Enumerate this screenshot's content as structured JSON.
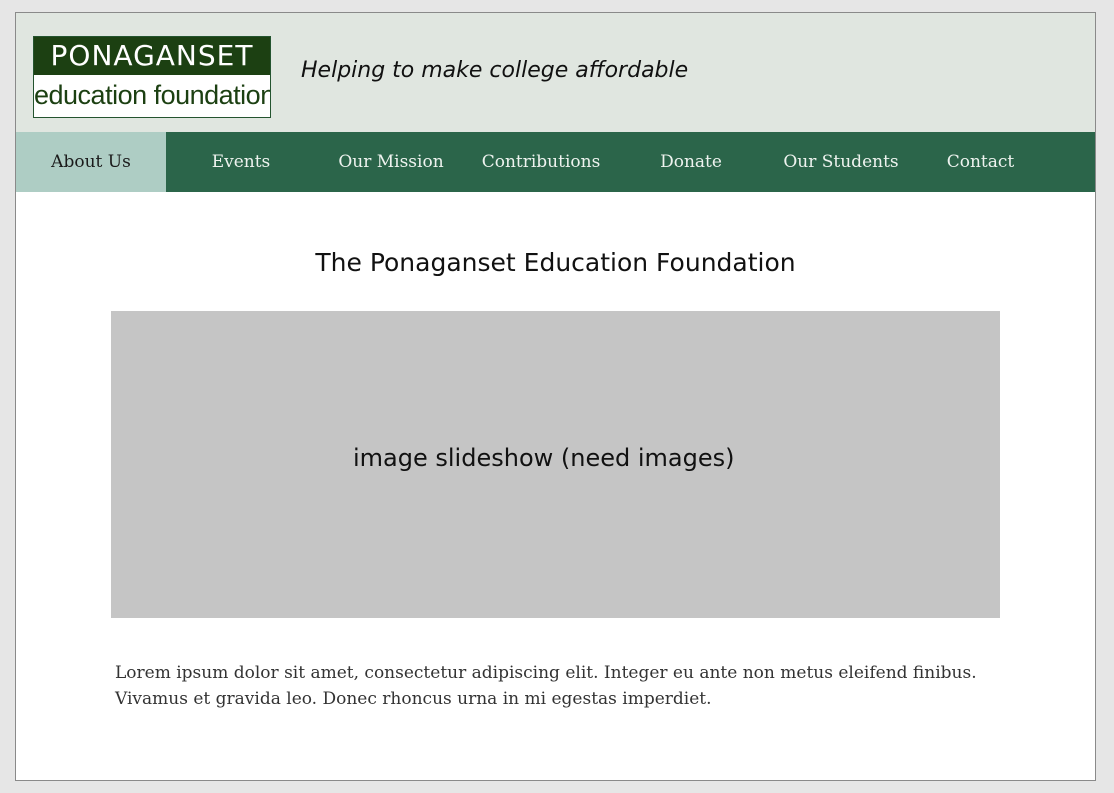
{
  "header": {
    "logo_line1": "PONAGANSET",
    "logo_line2": "education foundation",
    "tagline": "Helping to make college affordable"
  },
  "nav": {
    "items": [
      "About Us",
      "Events",
      "Our Mission",
      "Contributions",
      "Donate",
      "Our Students",
      "Contact"
    ],
    "active": "About Us"
  },
  "main": {
    "title": "The Ponaganset Education Foundation",
    "slideshow_label": "image slideshow (need images)",
    "paragraph_line1": "Lorem ipsum dolor sit amet, consectetur adipiscing elit. Integer eu ante non metus eleifend finibus.",
    "paragraph_line2": "Vivamus et gravida leo. Donec rhoncus urna in mi egestas imperdiet."
  },
  "colors": {
    "header_bg": "#e0e6e0",
    "nav_bg": "#2b654a",
    "nav_active_bg": "#aecdc4",
    "logo_green": "#1c4012",
    "slideshow_bg": "#c5c5c5"
  }
}
